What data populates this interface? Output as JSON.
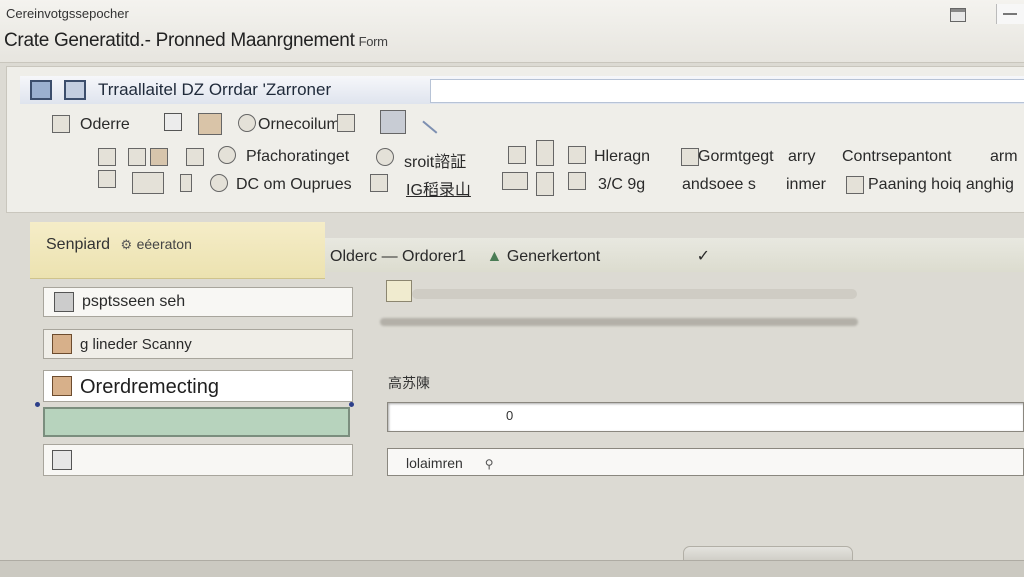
{
  "window": {
    "app_name": "Cereinvotgssepocher",
    "title": "Crate Generatitd.- Pronned Maanrgnement",
    "subtitle": "Form"
  },
  "ribbon": {
    "tab_label": "Trraallaitel DZ  Orrdar 'Zarroner",
    "row1": {
      "orders": "Oderre",
      "group": "Ornecoilum"
    },
    "row2": [
      "Pfachoratinget",
      "sroit諮証",
      "Hleragn",
      "Gormtgegt",
      "arry",
      "Contrsepantont",
      "arm"
    ],
    "row3": [
      "DC om Ouprues",
      "IG稻录山",
      "3/C 9g",
      "andsoee s",
      "inmer",
      "Paaning hoiq anghig"
    ]
  },
  "left_panel": {
    "header": "Senpiard",
    "header_tag": "eéeraton",
    "fields": [
      {
        "label": "psptsseen seh"
      },
      {
        "label": "g lineder Scanny"
      },
      {
        "label": "Orerdremecting"
      },
      {
        "label": ""
      },
      {
        "label": ""
      }
    ]
  },
  "main": {
    "breadcrumb": [
      "Olderc",
      "Ordorer1",
      "Generkertont"
    ],
    "form_label": "高苏陳",
    "order_value": "0",
    "category_label": "lolaimren"
  },
  "colors": {
    "ribbon_header": "#dfe4ee",
    "left_header": "#ece2b0",
    "selected_field": "#b7d3bd"
  }
}
